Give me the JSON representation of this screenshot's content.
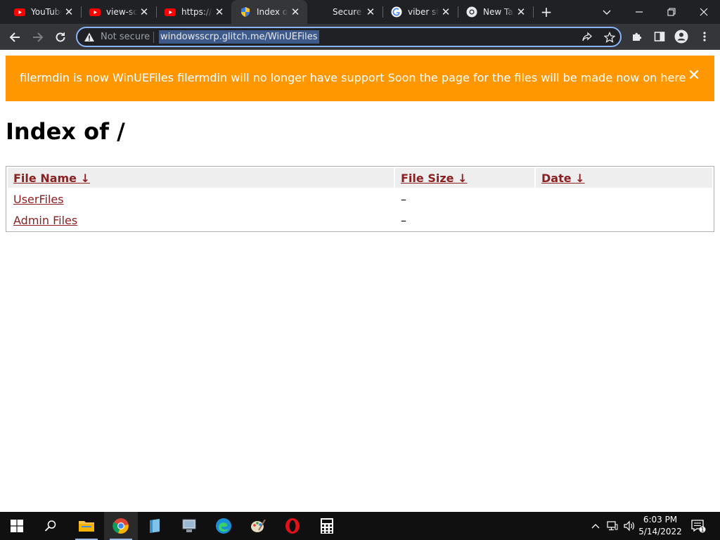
{
  "browser": {
    "tabs": [
      {
        "title": "YouTube",
        "favicon": "youtube-icon"
      },
      {
        "title": "view-source",
        "favicon": "youtube-icon"
      },
      {
        "title": "https://www",
        "favicon": "youtube-icon"
      },
      {
        "title": "Index of",
        "favicon": "shield-icon",
        "active": true
      },
      {
        "title": "Secure",
        "favicon": "none"
      },
      {
        "title": "viber sti",
        "favicon": "google-icon"
      },
      {
        "title": "New Tab",
        "favicon": "chrome-icon"
      }
    ],
    "address_bar": {
      "security_label": "Not secure",
      "url": "windowsscrp.glitch.me/WinUEFiles"
    }
  },
  "banner": {
    "message": "filermdin is now WinUEFiles filermdin will no longer have support Soon the page for the files will be made now on here",
    "color": "#ff9800"
  },
  "page": {
    "heading": "Index of /"
  },
  "table": {
    "headers": [
      {
        "label": "File Name",
        "sort": "↓"
      },
      {
        "label": "File Size",
        "sort": "↓"
      },
      {
        "label": "Date",
        "sort": "↓"
      }
    ],
    "rows": [
      {
        "name": "UserFiles",
        "size": "–",
        "date": ""
      },
      {
        "name": "Admin Files",
        "size": "–",
        "date": ""
      }
    ],
    "link_color": "#8b2020"
  },
  "taskbar": {
    "clock_time": "6:03 PM",
    "clock_date": "5/14/2022",
    "notification_count": "1"
  }
}
